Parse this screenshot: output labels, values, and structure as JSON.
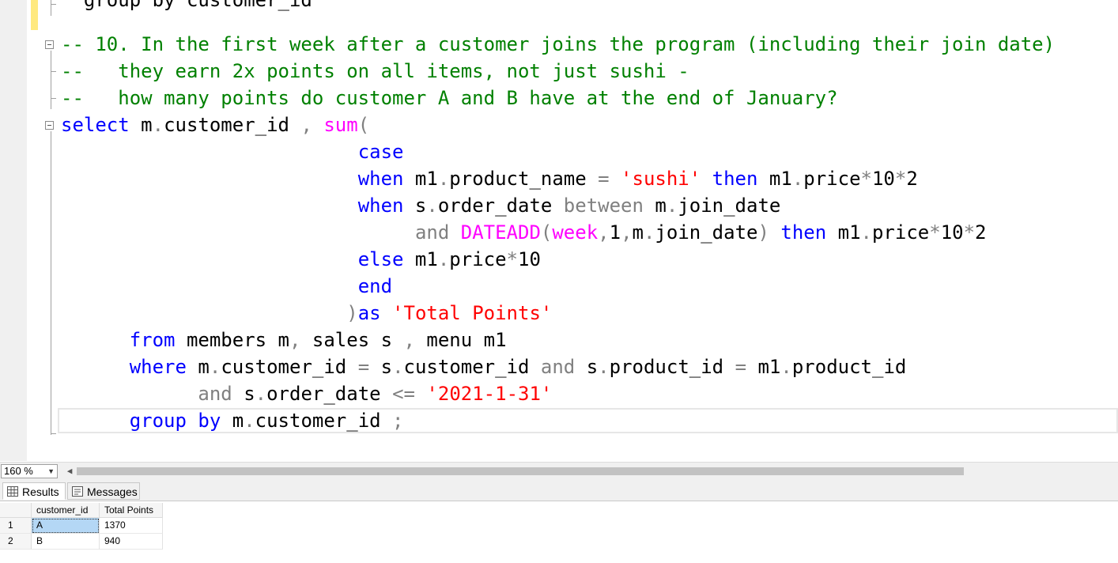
{
  "editor": {
    "cut_line": "  group by customer_id",
    "lines": [
      [
        {
          "c": "cm",
          "t": "-- 10. In the first week after a customer joins the program (including their join date)"
        }
      ],
      [
        {
          "c": "cm",
          "t": "--   they earn 2x points on all items, not just sushi -"
        }
      ],
      [
        {
          "c": "cm",
          "t": "--   how many points do customer A and B have at the end of January?"
        }
      ],
      [
        {
          "c": "kw",
          "t": "select"
        },
        {
          "c": "tx",
          "t": " m"
        },
        {
          "c": "op",
          "t": "."
        },
        {
          "c": "tx",
          "t": "customer_id "
        },
        {
          "c": "op",
          "t": ","
        },
        {
          "c": "tx",
          "t": " "
        },
        {
          "c": "fn",
          "t": "sum"
        },
        {
          "c": "op",
          "t": "("
        }
      ],
      [
        {
          "c": "tx",
          "t": "                          "
        },
        {
          "c": "kw",
          "t": "case"
        }
      ],
      [
        {
          "c": "tx",
          "t": "                          "
        },
        {
          "c": "kw",
          "t": "when"
        },
        {
          "c": "tx",
          "t": " m1"
        },
        {
          "c": "op",
          "t": "."
        },
        {
          "c": "tx",
          "t": "product_name "
        },
        {
          "c": "op",
          "t": "="
        },
        {
          "c": "tx",
          "t": " "
        },
        {
          "c": "st",
          "t": "'sushi'"
        },
        {
          "c": "tx",
          "t": " "
        },
        {
          "c": "kw",
          "t": "then"
        },
        {
          "c": "tx",
          "t": " m1"
        },
        {
          "c": "op",
          "t": "."
        },
        {
          "c": "tx",
          "t": "price"
        },
        {
          "c": "op",
          "t": "*"
        },
        {
          "c": "tx",
          "t": "10"
        },
        {
          "c": "op",
          "t": "*"
        },
        {
          "c": "tx",
          "t": "2"
        }
      ],
      [
        {
          "c": "tx",
          "t": "                          "
        },
        {
          "c": "kw",
          "t": "when"
        },
        {
          "c": "tx",
          "t": " s"
        },
        {
          "c": "op",
          "t": "."
        },
        {
          "c": "tx",
          "t": "order_date "
        },
        {
          "c": "op",
          "t": "between"
        },
        {
          "c": "tx",
          "t": " m"
        },
        {
          "c": "op",
          "t": "."
        },
        {
          "c": "tx",
          "t": "join_date"
        }
      ],
      [
        {
          "c": "tx",
          "t": "                               "
        },
        {
          "c": "op",
          "t": "and"
        },
        {
          "c": "tx",
          "t": " "
        },
        {
          "c": "fn",
          "t": "DATEADD"
        },
        {
          "c": "op",
          "t": "("
        },
        {
          "c": "fn",
          "t": "week"
        },
        {
          "c": "op",
          "t": ","
        },
        {
          "c": "tx",
          "t": "1"
        },
        {
          "c": "op",
          "t": ","
        },
        {
          "c": "tx",
          "t": "m"
        },
        {
          "c": "op",
          "t": "."
        },
        {
          "c": "tx",
          "t": "join_date"
        },
        {
          "c": "op",
          "t": ")"
        },
        {
          "c": "tx",
          "t": " "
        },
        {
          "c": "kw",
          "t": "then"
        },
        {
          "c": "tx",
          "t": " m1"
        },
        {
          "c": "op",
          "t": "."
        },
        {
          "c": "tx",
          "t": "price"
        },
        {
          "c": "op",
          "t": "*"
        },
        {
          "c": "tx",
          "t": "10"
        },
        {
          "c": "op",
          "t": "*"
        },
        {
          "c": "tx",
          "t": "2"
        }
      ],
      [
        {
          "c": "tx",
          "t": "                          "
        },
        {
          "c": "kw",
          "t": "else"
        },
        {
          "c": "tx",
          "t": " m1"
        },
        {
          "c": "op",
          "t": "."
        },
        {
          "c": "tx",
          "t": "price"
        },
        {
          "c": "op",
          "t": "*"
        },
        {
          "c": "tx",
          "t": "10"
        }
      ],
      [
        {
          "c": "tx",
          "t": "                          "
        },
        {
          "c": "kw",
          "t": "end"
        }
      ],
      [
        {
          "c": "tx",
          "t": "                         "
        },
        {
          "c": "op",
          "t": ")"
        },
        {
          "c": "kw",
          "t": "as"
        },
        {
          "c": "tx",
          "t": " "
        },
        {
          "c": "st",
          "t": "'Total Points'"
        }
      ],
      [
        {
          "c": "tx",
          "t": "      "
        },
        {
          "c": "kw",
          "t": "from"
        },
        {
          "c": "tx",
          "t": " members m"
        },
        {
          "c": "op",
          "t": ","
        },
        {
          "c": "tx",
          "t": " sales s "
        },
        {
          "c": "op",
          "t": ","
        },
        {
          "c": "tx",
          "t": " menu m1"
        }
      ],
      [
        {
          "c": "tx",
          "t": "      "
        },
        {
          "c": "kw",
          "t": "where"
        },
        {
          "c": "tx",
          "t": " m"
        },
        {
          "c": "op",
          "t": "."
        },
        {
          "c": "tx",
          "t": "customer_id "
        },
        {
          "c": "op",
          "t": "="
        },
        {
          "c": "tx",
          "t": " s"
        },
        {
          "c": "op",
          "t": "."
        },
        {
          "c": "tx",
          "t": "customer_id "
        },
        {
          "c": "op",
          "t": "and"
        },
        {
          "c": "tx",
          "t": " s"
        },
        {
          "c": "op",
          "t": "."
        },
        {
          "c": "tx",
          "t": "product_id "
        },
        {
          "c": "op",
          "t": "="
        },
        {
          "c": "tx",
          "t": " m1"
        },
        {
          "c": "op",
          "t": "."
        },
        {
          "c": "tx",
          "t": "product_id"
        }
      ],
      [
        {
          "c": "tx",
          "t": "            "
        },
        {
          "c": "op",
          "t": "and"
        },
        {
          "c": "tx",
          "t": " s"
        },
        {
          "c": "op",
          "t": "."
        },
        {
          "c": "tx",
          "t": "order_date "
        },
        {
          "c": "op",
          "t": "<="
        },
        {
          "c": "tx",
          "t": " "
        },
        {
          "c": "st",
          "t": "'2021-1-31'"
        }
      ],
      [
        {
          "c": "tx",
          "t": "      "
        },
        {
          "c": "kw",
          "t": "group by"
        },
        {
          "c": "tx",
          "t": " m"
        },
        {
          "c": "op",
          "t": "."
        },
        {
          "c": "tx",
          "t": "customer_id "
        },
        {
          "c": "op",
          "t": ";"
        }
      ]
    ]
  },
  "status": {
    "zoom": "160 %"
  },
  "tabs": {
    "results": "Results",
    "messages": "Messages"
  },
  "results": {
    "columns": [
      "customer_id",
      "Total Points"
    ],
    "rows": [
      {
        "num": "1",
        "customer_id": "A",
        "total_points": "1370"
      },
      {
        "num": "2",
        "customer_id": "B",
        "total_points": "940"
      }
    ]
  }
}
